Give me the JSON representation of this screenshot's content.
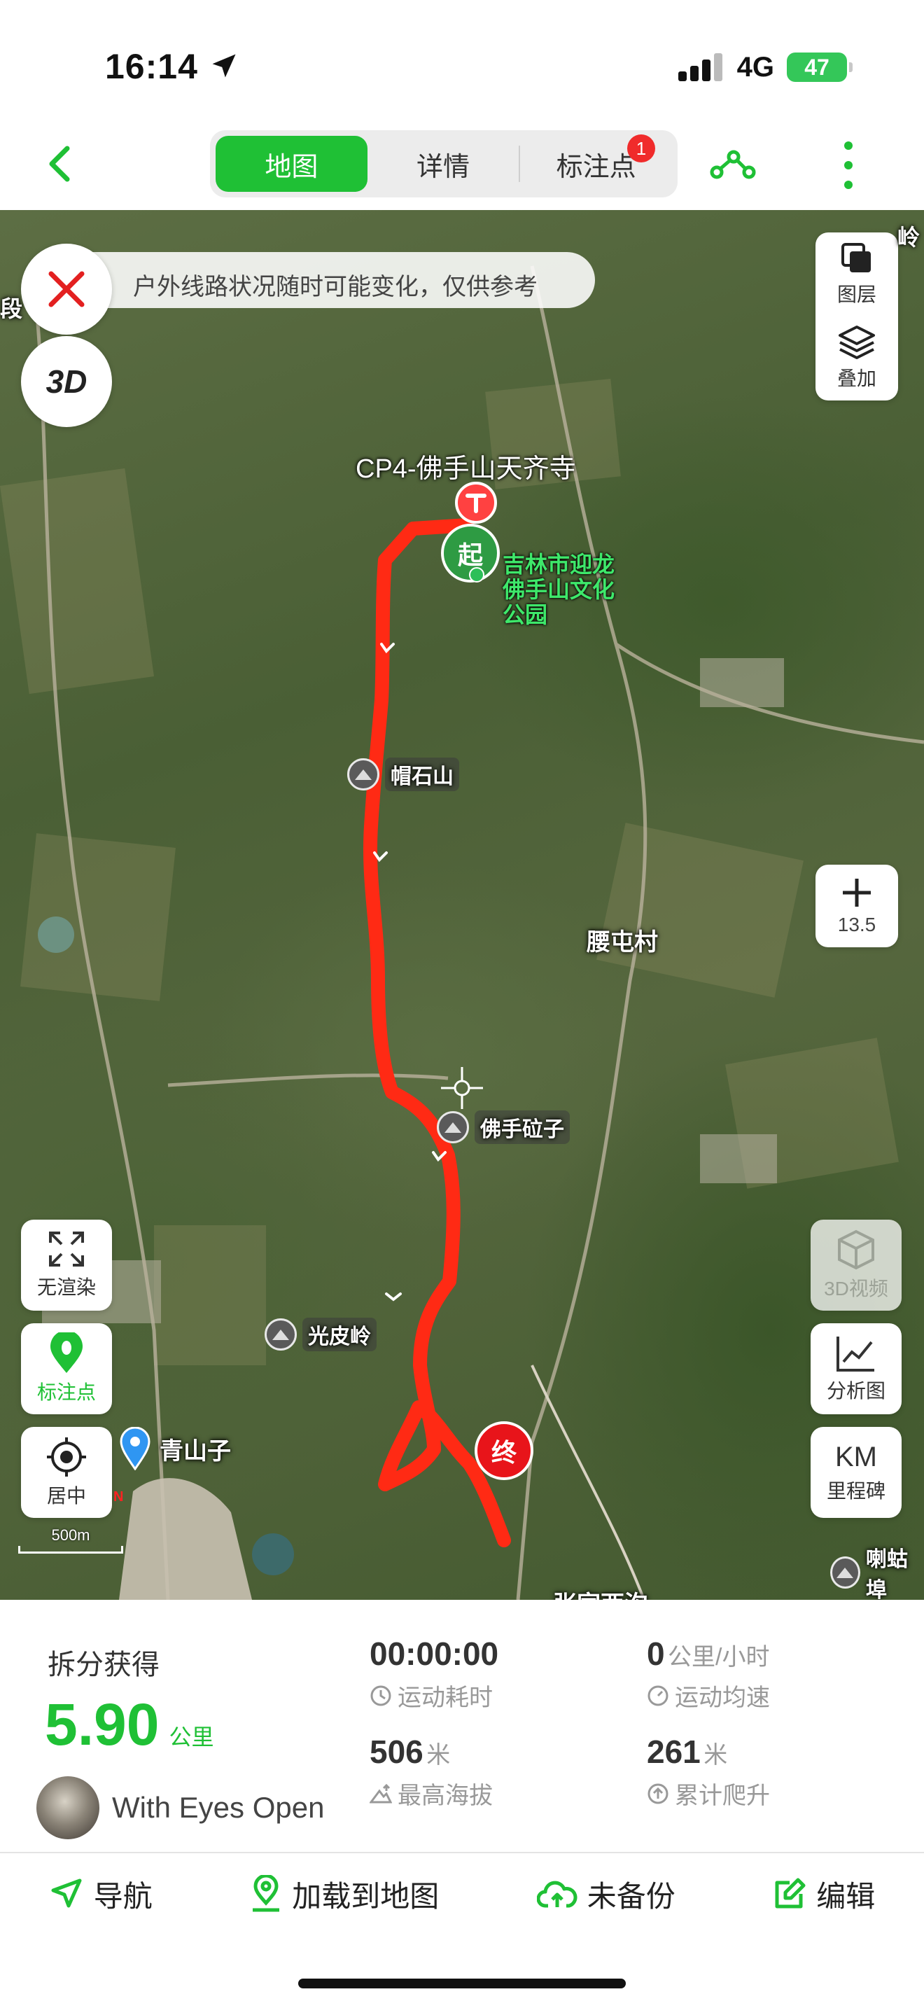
{
  "status": {
    "time": "16:14",
    "network": "4G",
    "battery": "47"
  },
  "nav": {
    "tabs": [
      {
        "label": "地图",
        "active": true
      },
      {
        "label": "详情",
        "active": false
      },
      {
        "label": "标注点",
        "active": false,
        "badge": "1"
      }
    ]
  },
  "map": {
    "notice": "户外线路状况随时可能变化，仅供参考",
    "btn_3d": "3D",
    "layer_label": "图层",
    "overlay_label": "叠加",
    "zoom_level": "13.5",
    "left_buttons": {
      "no_render": "无渲染",
      "waypoints": "标注点",
      "center": "居中"
    },
    "right_buttons": {
      "video3d": "3D视频",
      "analysis": "分析图",
      "km_icon": "KM",
      "milestones": "里程碑"
    },
    "places": {
      "checkpoint": "CP4-佛手山天齐寺",
      "start_marker": "起",
      "end_marker": "终",
      "park": "吉林市迎龙佛手山文化公园",
      "peak1": "帽石山",
      "village": "腰屯村",
      "peak2": "佛手砬子",
      "peak3": "光皮岭",
      "town": "青山子",
      "edge_top_right": "岭",
      "edge_left": "段",
      "edge_bottom_right": "喇蛄埠",
      "edge_bottom": "张家西沟"
    },
    "scale": "500m",
    "colors": {
      "route": "#ff2a14",
      "accent": "#1fc035"
    }
  },
  "summary": {
    "title": "拆分获得",
    "distance": "5.90",
    "distance_unit": "公里",
    "author": "With Eyes Open",
    "duration": "00:00:00",
    "duration_label": "运动耗时",
    "speed": "0",
    "speed_unit": "公里/小时",
    "speed_label": "运动均速",
    "max_alt": "506",
    "max_alt_unit": "米",
    "max_alt_label": "最高海拔",
    "climb": "261",
    "climb_unit": "米",
    "climb_label": "累计爬升"
  },
  "actions": {
    "navigate": "导航",
    "load": "加载到地图",
    "backup": "未备份",
    "edit": "编辑"
  }
}
